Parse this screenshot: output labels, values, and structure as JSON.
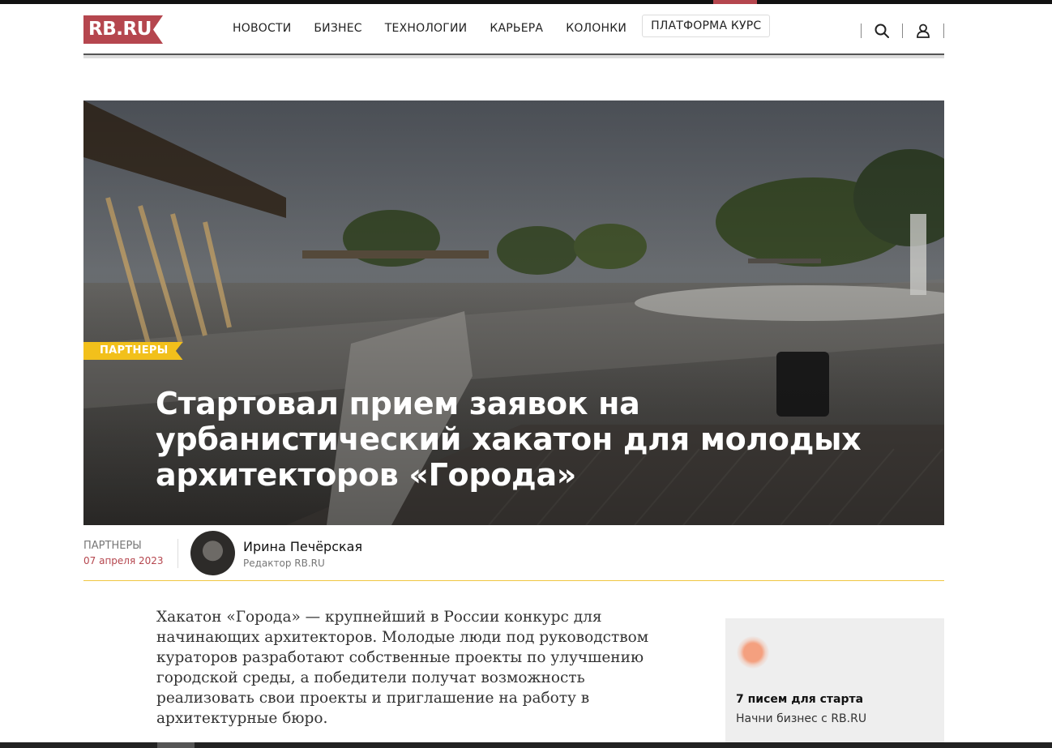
{
  "logo": {
    "text": "RB.RU",
    "color": "#b5464e"
  },
  "nav": {
    "items": [
      "НОВОСТИ",
      "БИЗНЕС",
      "ТЕХНОЛОГИИ",
      "КАРЬЕРА",
      "КОЛОНКИ"
    ],
    "platform": "ПЛАТФОРМА КУРС"
  },
  "tools": {
    "search_icon": "search-icon",
    "user_icon": "user-icon"
  },
  "hero": {
    "tag": "ПАРТНЕРЫ",
    "tag_color": "#f2c01b",
    "title": "Стартовал прием заявок на урбанистический хакатон для молодых архитекторов «Города»"
  },
  "meta": {
    "category": "ПАРТНЕРЫ",
    "date": "07 апреля 2023",
    "author_name": "Ирина Печёрская",
    "author_role": "Редактор RB.RU"
  },
  "article": {
    "lead": "Хакатон «Города» — крупнейший в России конкурс для начинающих архитекторов. Молодые люди под руководством кураторов разработают собственные проекты по улучшению городской среды, а победители получат возможность реализовать свои проекты и приглашение на работу в архитектурные бюро."
  },
  "promo": {
    "title": "7 писем для старта",
    "subtitle": "Начни бизнес с RB.RU"
  }
}
